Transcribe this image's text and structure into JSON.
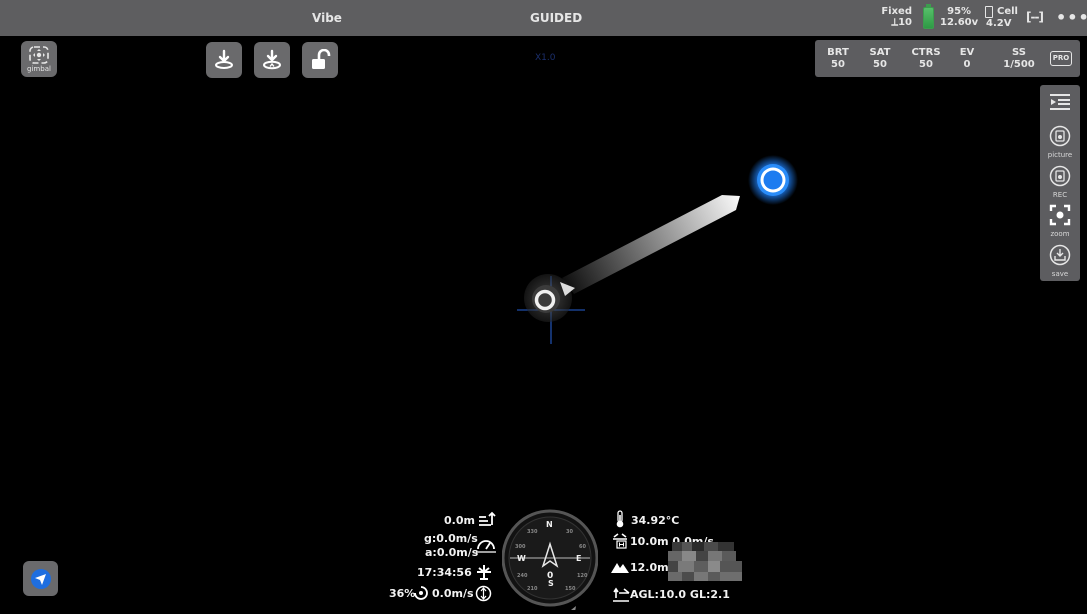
{
  "topbar": {
    "vibe": "Vibe",
    "mode": "GUIDED",
    "gps_fix": "Fixed",
    "gps_sats": "⟂10",
    "battery_percent": "95%",
    "battery_voltage": "12.60v",
    "cell_label": "Cell",
    "cell_voltage": "4.2V",
    "link_icon": "[--]",
    "more": "•••"
  },
  "left_controls": {
    "gimbal_label": "gimbal"
  },
  "zoom_ratio": "X1.0",
  "camera": {
    "brt_label": "BRT",
    "brt_value": "50",
    "sat_label": "SAT",
    "sat_value": "50",
    "ctrs_label": "CTRS",
    "ctrs_value": "50",
    "ev_label": "EV",
    "ev_value": "0",
    "ss_label": "SS",
    "ss_value": "1/500",
    "pro_label": "PRO"
  },
  "sidebar": {
    "picture_label": "picture",
    "rec_label": "REC",
    "zoom_label": "zoom",
    "save_label": "save"
  },
  "telemetry": {
    "altitude": "0.0m",
    "ground_speed": "g:0.0m/s",
    "air_speed": "a:0.0m/s",
    "flight_time": "17:34:56",
    "throttle": "36%",
    "vertical_speed": "0.0m/s",
    "temperature": "34.92°C",
    "home_dist": "10.0m 0.0m/s",
    "terrain_alt": "12.0m",
    "agl": "AGL:10.0 GL:2.1"
  },
  "compass": {
    "heading": "0",
    "n": "N",
    "e": "E",
    "s": "S",
    "w": "W",
    "deg30": "30",
    "deg60": "60",
    "deg120": "120",
    "deg150": "150",
    "deg210": "210",
    "deg240": "240",
    "deg300": "300",
    "deg330": "330"
  },
  "colors": {
    "bar_bg": "#5e5e60",
    "button_bg": "#6a6a6c",
    "waypoint_blue": "#1e7cf0",
    "battery_green": "#3c9d4e"
  },
  "icons": {
    "gimbal": "gimbal-icon",
    "land": "land-icon",
    "rtl": "return-home-icon",
    "unlock": "unlock-icon",
    "navigate": "navigate-icon",
    "menu": "menu-collapse-icon",
    "picture": "camera-icon",
    "record": "record-icon",
    "zoom": "zoom-frame-icon",
    "save": "save-icon"
  }
}
